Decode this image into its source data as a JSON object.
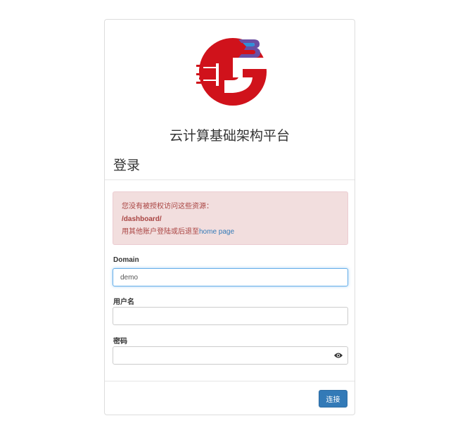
{
  "header": {
    "platform_title": "云计算基础架构平台",
    "login_heading": "登录"
  },
  "alert": {
    "line1": "您没有被授权访问这些资源：",
    "path": "/dashboard/",
    "line3_prefix": "用其他账户登陆或后退至",
    "home_link": "home page"
  },
  "form": {
    "domain_label": "Domain",
    "domain_value": "demo",
    "username_label": "用户名",
    "username_value": "",
    "password_label": "密码",
    "password_value": "",
    "submit_label": "连接"
  },
  "icons": {
    "logo": "brand-logo",
    "password_toggle": "eye-icon"
  },
  "colors": {
    "logo_red": "#d0121b",
    "logo_purple": "#6a4fa3",
    "alert_bg": "#f2dede",
    "alert_text": "#a94442",
    "link": "#337ab7",
    "button": "#337ab7"
  }
}
